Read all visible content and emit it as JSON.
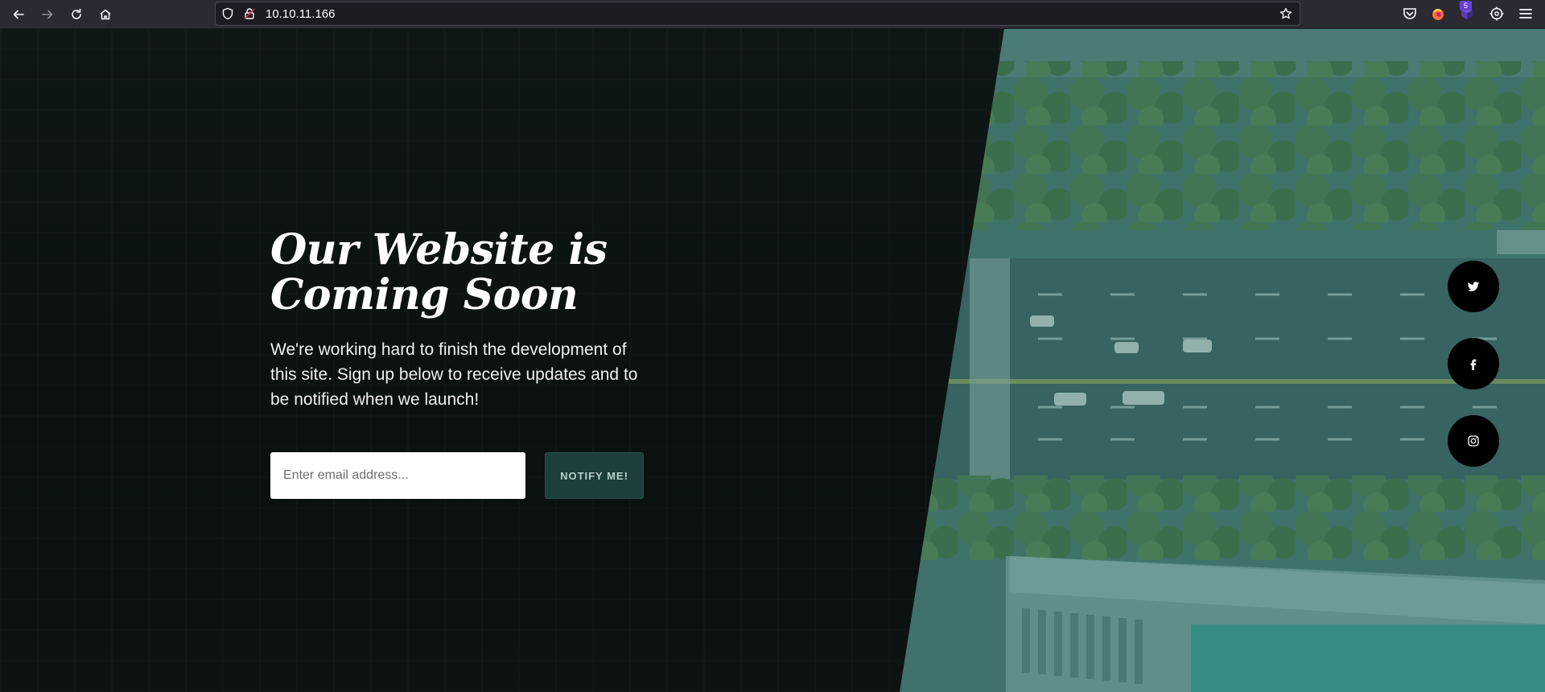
{
  "browser": {
    "url": "10.10.11.166",
    "extension_badge": "5",
    "icons": [
      "back-icon",
      "forward-icon",
      "reload-icon",
      "home-icon",
      "tracking-shield-icon",
      "lock-icon",
      "bookmark-star-icon",
      "pocket-icon",
      "firefox-extension-icon",
      "extension-icon",
      "settings-gear-icon",
      "menu-icon"
    ]
  },
  "hero": {
    "heading": "Our Website is Coming Soon",
    "description": "We're working hard to finish the development of this site. Sign up below to receive updates and to be notified when we launch!",
    "email_placeholder": "Enter email address...",
    "notify_label": "NOTIFY ME!"
  },
  "social": [
    {
      "name": "twitter",
      "icon": "twitter-icon"
    },
    {
      "name": "facebook",
      "icon": "facebook-icon"
    },
    {
      "name": "instagram",
      "icon": "instagram-icon"
    }
  ],
  "colors": {
    "chrome_bg": "#2b2a33",
    "page_dark": "#0b1110",
    "photo_tint": "#4f7d73",
    "button_bg": "#1d3f3b",
    "social_bg": "#000000"
  }
}
